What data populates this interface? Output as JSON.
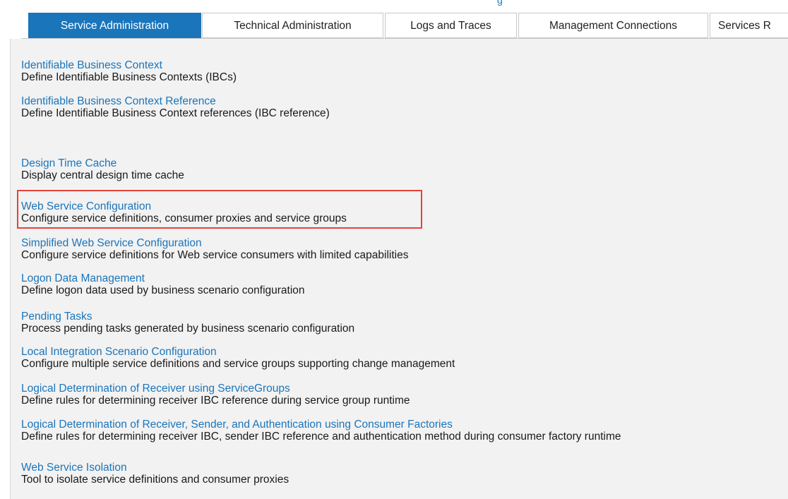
{
  "top_link": "g",
  "tabs": [
    {
      "label": "Service Administration",
      "active": true
    },
    {
      "label": "Technical Administration",
      "active": false
    },
    {
      "label": "Logs and Traces",
      "active": false
    },
    {
      "label": "Management Connections",
      "active": false
    },
    {
      "label": "Services R",
      "active": false
    }
  ],
  "entries": [
    {
      "title": "Identifiable Business Context",
      "description": "Define Identifiable Business Contexts (IBCs)"
    },
    {
      "title": "Identifiable Business Context Reference",
      "description": "Define Identifiable Business Context references (IBC reference)"
    },
    {
      "title": "Design Time Cache",
      "description": "Display central design time cache"
    },
    {
      "title": "Web Service Configuration",
      "description": "Configure service definitions, consumer proxies and service groups"
    },
    {
      "title": "Simplified Web Service Configuration",
      "description": "Configure service definitions for Web service consumers with limited capabilities"
    },
    {
      "title": "Logon Data Management",
      "description": "Define logon data used by business scenario configuration"
    },
    {
      "title": "Pending Tasks",
      "description": "Process pending tasks generated by business scenario configuration"
    },
    {
      "title": "Local Integration Scenario Configuration",
      "description": "Configure multiple service definitions and service groups supporting change management"
    },
    {
      "title": "Logical Determination of Receiver using ServiceGroups",
      "description": "Define rules for determining receiver IBC reference during service group runtime"
    },
    {
      "title": "Logical Determination of Receiver, Sender, and Authentication using Consumer Factories",
      "description": "Define rules for determining receiver IBC, sender IBC reference and authentication method during consumer factory runtime"
    },
    {
      "title": "Web Service Isolation",
      "description": "Tool to isolate service definitions and consumer proxies"
    }
  ],
  "highlighted_entry": "Web Service Configuration",
  "colors": {
    "accent": "#1a75bb",
    "highlight": "#e8413b",
    "panel": "#f2f2f2"
  }
}
